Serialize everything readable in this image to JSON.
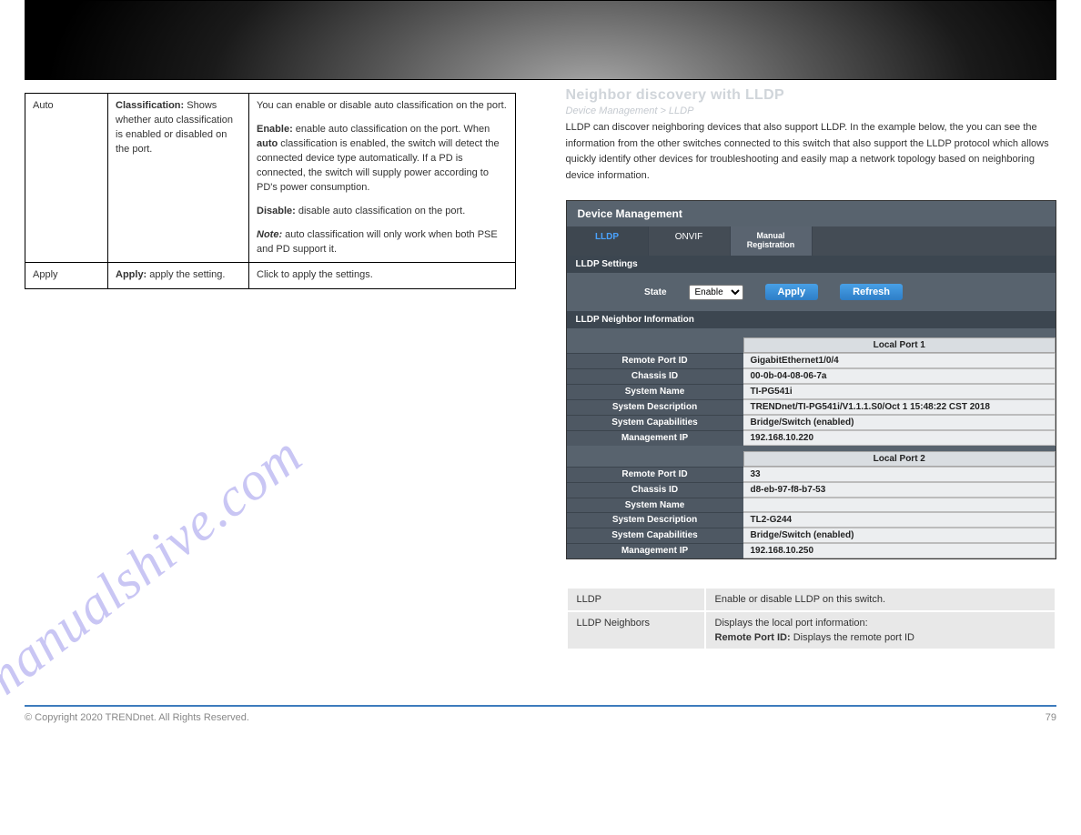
{
  "leftTable": {
    "row1": {
      "c1": "Auto",
      "c2_bold": "Classification:",
      "c2_rest": " Shows whether auto classification is enabled or disabled on the port.",
      "c3_line1": "You can enable or disable auto classification on the port.",
      "c3_para2_b1": "Enable:",
      "c3_para2_r1": " enable auto classification on the port. When",
      "c3_para2_b2": "auto",
      "c3_para2_r2": " classification is enabled, the switch will detect the connected device type automatically. If a PD is connected, the switch will supply power according to PD's power consumption.",
      "c3_para3_b1": "Disable:",
      "c3_para3_r1": " disable auto classification on the port.",
      "c3_para4_bi": "Note:",
      "c3_para4_r": " auto classification will only work when both PSE and PD support it."
    },
    "row2": {
      "c1": "Apply",
      "c2_bold": "Apply:",
      "c2_rest": " apply the setting.",
      "c3": "Click to apply the settings."
    }
  },
  "right": {
    "sectionTitle": "Neighbor discovery with LLDP",
    "subPath": "Device Management > LLDP",
    "desc": "LLDP can discover neighboring devices that also support LLDP. In the example below, the you can see the information from the other switches connected to this switch that also support the LLDP protocol which allows quickly identify other devices for troubleshooting and easily map a network topology based on neighboring device information.",
    "panel": {
      "title": "Device Management",
      "tabs": {
        "t1": "LLDP",
        "t2": "ONVIF",
        "t3": "Manual\nRegistration"
      },
      "sec1": "LLDP Settings",
      "stateLabel": "State",
      "stateSelect": "Enable",
      "applyBtn": "Apply",
      "refreshBtn": "Refresh",
      "sec2": "LLDP Neighbor Information",
      "localPort1": "Local Port 1",
      "localPort2": "Local Port 2",
      "keys": {
        "rpid": "Remote Port ID",
        "cid": "Chassis ID",
        "sname": "System Name",
        "sdesc": "System Description",
        "scap": "System Capabilities",
        "mip": "Management IP"
      },
      "p1": {
        "rpid": "GigabitEthernet1/0/4",
        "cid": "00-0b-04-08-06-7a",
        "sname": "TI-PG541i",
        "sdesc": "TRENDnet/TI-PG541i/V1.1.1.S0/Oct 1 15:48:22 CST 2018",
        "scap": "Bridge/Switch (enabled)",
        "mip": "192.168.10.220"
      },
      "p2": {
        "rpid": "33",
        "cid": "d8-eb-97-f8-b7-53",
        "sname": "",
        "sdesc": "TL2-G244",
        "scap": "Bridge/Switch (enabled)",
        "mip": "192.168.10.250"
      }
    },
    "grayTable": {
      "r1c1": "LLDP",
      "r1c2": "Enable or disable LLDP on this switch.",
      "r2c1": "LLDP Neighbors",
      "r2c2": "Displays the local port information:",
      "r2c2b": "Remote Port ID:",
      "r2c2r": "Displays the remote port ID"
    }
  },
  "footer": {
    "left": "© Copyright 2020 TRENDnet. All Rights Reserved.",
    "right": "79"
  },
  "watermark": "manualshive.com"
}
